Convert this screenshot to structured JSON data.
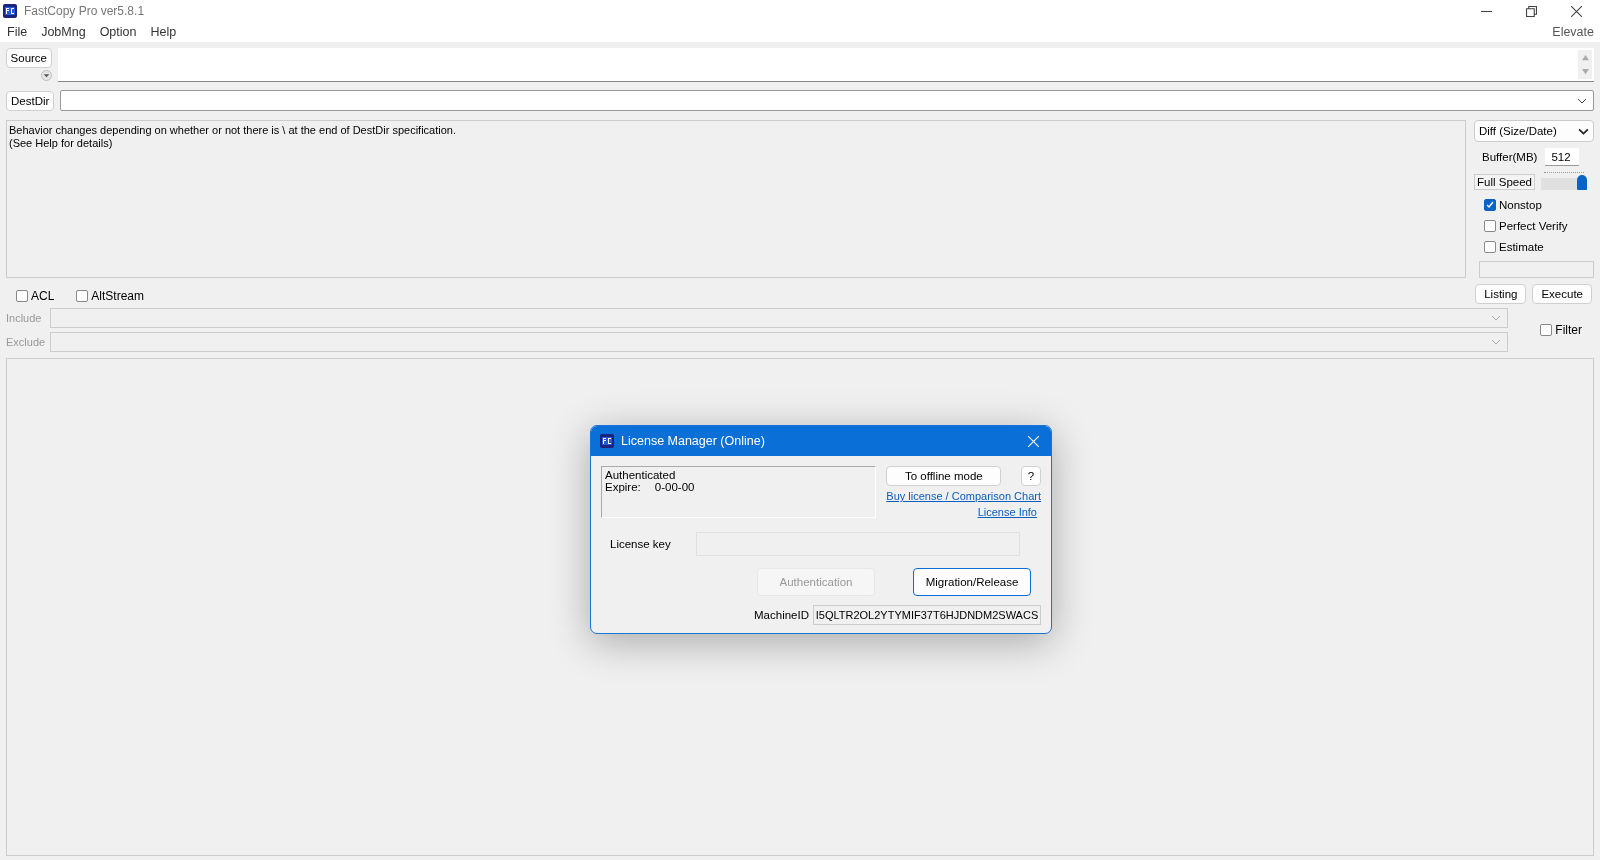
{
  "window": {
    "title": "FastCopy Pro ver5.8.1",
    "elevate": "Elevate"
  },
  "menu": [
    {
      "label": "File"
    },
    {
      "label": "JobMng"
    },
    {
      "label": "Option"
    },
    {
      "label": "Help"
    }
  ],
  "source": {
    "button": "Source"
  },
  "destdir": {
    "button": "DestDir"
  },
  "message_lines": [
    "Behavior changes depending on whether or not there is \\ at the end of DestDir specification.",
    "(See Help for details)"
  ],
  "mode": "Diff (Size/Date)",
  "buffer": {
    "label": "Buffer(MB)",
    "value": "512"
  },
  "speed": {
    "label": "Full Speed",
    "level": 1.0
  },
  "options": [
    {
      "label": "Nonstop",
      "checked": true
    },
    {
      "label": "Perfect Verify",
      "checked": false
    },
    {
      "label": "Estimate",
      "checked": false
    }
  ],
  "flags": [
    {
      "label": "ACL",
      "checked": false
    },
    {
      "label": "AltStream",
      "checked": false
    }
  ],
  "actions": [
    "Listing",
    "Execute"
  ],
  "filters": [
    {
      "label": "Include",
      "disabled": true
    },
    {
      "label": "Exclude",
      "disabled": true
    }
  ],
  "filter_toggle": {
    "label": "Filter",
    "checked": false
  },
  "dialog": {
    "title": "License Manager (Online)",
    "status": "Authenticated",
    "expire_label": "Expire:",
    "expire_value": "0-00-00",
    "offline_button": "To offline mode",
    "help_button": "?",
    "links": [
      "Buy license / Comparison Chart",
      "License Info"
    ],
    "license_key_label": "License key",
    "buttons": [
      {
        "label": "Authentication",
        "disabled": true
      },
      {
        "label": "Migration/Release",
        "disabled": false
      }
    ],
    "machine_id_label": "MachineID",
    "machine_id": "I5QLTR2OL2YTYMIF37T6HJDNDM2SWACS"
  }
}
